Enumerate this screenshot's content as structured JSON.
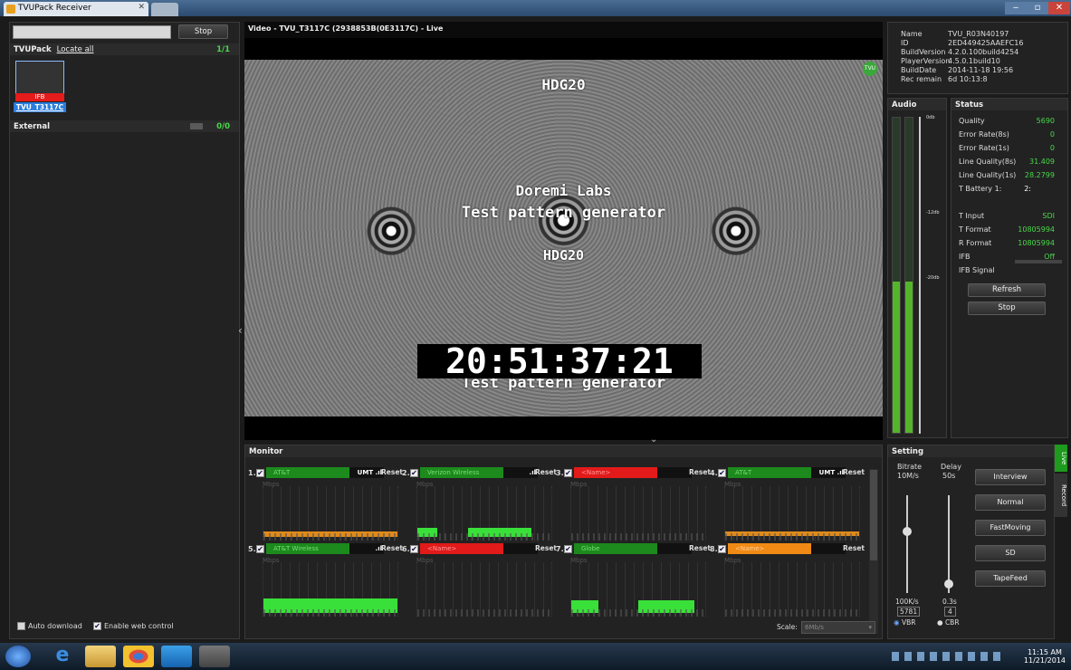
{
  "window": {
    "title": "TVUPack Receiver",
    "controls": [
      "‒",
      "▫",
      "✕"
    ]
  },
  "left": {
    "search_value": "",
    "stop_label": "Stop",
    "tvupack_label": "TVUPack",
    "locate_all": "Locate all",
    "tvupack_count": "1/1",
    "thumb_badge": "IFB",
    "thumb_name": "TVU_T3117C",
    "external_label": "External",
    "external_count": "0/0",
    "auto_download": "Auto download",
    "enable_web": "Enable web control"
  },
  "video": {
    "title": "Video - TVU_T3117C (2938853B(0E3117C) - Live",
    "overlay_top": "HDG20",
    "overlay_l1": "Doremi Labs",
    "overlay_l2": "Test pattern generator",
    "overlay_mid": "HDG20",
    "timecode": "20:51:37:21",
    "overlay_bottom": "Test pattern generator",
    "badge": "TVU"
  },
  "info": {
    "rows": [
      {
        "k": "Name",
        "v": "TVU_R03N40197"
      },
      {
        "k": "ID",
        "v": "2ED449425AAEFC16"
      },
      {
        "k": "BuildVersion",
        "v": "4.2.0.100build4254"
      },
      {
        "k": "PlayerVersion",
        "v": "4.5.0.1build10"
      },
      {
        "k": "BuildDate",
        "v": "2014-11-18 19:56"
      },
      {
        "k": "Rec remain",
        "v": "6d 10:13:8"
      }
    ]
  },
  "audio": {
    "title": "Audio",
    "scale": [
      "0db",
      "-12db",
      "-20db"
    ],
    "level_left": 0.48,
    "level_right": 0.48
  },
  "status": {
    "title": "Status",
    "rows": [
      {
        "k": "Quality",
        "v": "5690"
      },
      {
        "k": "Error Rate(8s)",
        "v": "0"
      },
      {
        "k": "Error Rate(1s)",
        "v": "0"
      },
      {
        "k": "Line Quality(8s)",
        "v": "31.409"
      },
      {
        "k": "Line Quality(1s)",
        "v": "28.2799"
      },
      {
        "k": "T Battery  1:",
        "v": "2:"
      },
      {
        "k": "",
        "v": ""
      },
      {
        "k": "T Input",
        "v": "SDI"
      },
      {
        "k": "T Format",
        "v": "10805994"
      },
      {
        "k": "R Format",
        "v": "10805994"
      },
      {
        "k": "IFB",
        "v": "Off"
      },
      {
        "k": "IFB Signal",
        "v": ""
      }
    ],
    "refresh": "Refresh",
    "stop": "Stop"
  },
  "monitor": {
    "title": "Monitor",
    "channels": [
      {
        "num": "1.",
        "name": "AT&T",
        "extra": "UMT .ıl",
        "color": "green"
      },
      {
        "num": "2.",
        "name": "Verizon Wireless",
        "extra": ".ıl",
        "color": "green"
      },
      {
        "num": "3.",
        "name": "<Name>",
        "extra": "",
        "color": "red"
      },
      {
        "num": "4.",
        "name": "AT&T",
        "extra": "UMT .ıl",
        "color": "green"
      },
      {
        "num": "5.",
        "name": "AT&T Wireless",
        "extra": ".ıl",
        "color": "green"
      },
      {
        "num": "6.",
        "name": "<Name>",
        "extra": "",
        "color": "red"
      },
      {
        "num": "7.",
        "name": "Globe",
        "extra": "",
        "color": "green"
      },
      {
        "num": "8.",
        "name": "<Name>",
        "extra": "",
        "color": "orange"
      }
    ],
    "reset": "Reset",
    "unit": "Mbps",
    "scale_label": "Scale:",
    "scale_value": "6Mb/s"
  },
  "setting": {
    "title": "Setting",
    "bitrate_label": "Bitrate",
    "bitrate_max": "10M/s",
    "delay_label": "Delay",
    "delay_max": "50s",
    "bitrate_min": "100K/s",
    "delay_min": "0.3s",
    "bitrate_value": "5781",
    "delay_value": "4",
    "vbr": "VBR",
    "cbr": "CBR",
    "buttons": [
      "Interview",
      "Normal",
      "FastMoving",
      "SD",
      "TapeFeed"
    ],
    "tabs": [
      "Live",
      "Record"
    ]
  },
  "taskbar": {
    "time": "11:15 AM",
    "date": "11/21/2014"
  }
}
